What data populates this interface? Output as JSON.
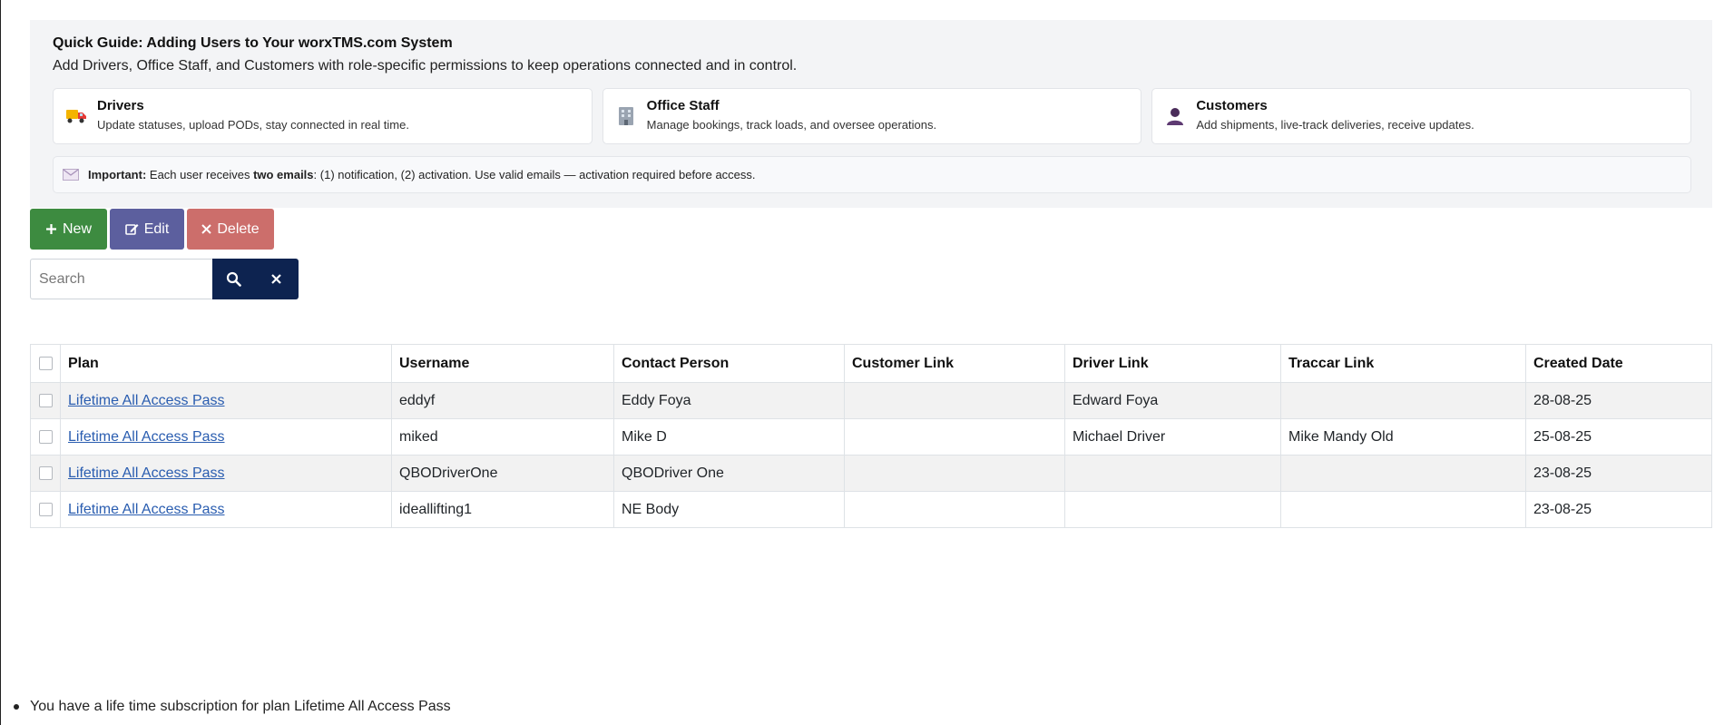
{
  "guide": {
    "title": "Quick Guide: Adding Users to Your worxTMS.com System",
    "subtitle": "Add Drivers, Office Staff, and Customers with role-specific permissions to keep operations connected and in control.",
    "cards": [
      {
        "title": "Drivers",
        "desc": "Update statuses, upload PODs, stay connected in real time.",
        "icon": "truck-icon"
      },
      {
        "title": "Office Staff",
        "desc": "Manage bookings, track loads, and oversee operations.",
        "icon": "office-building-icon"
      },
      {
        "title": "Customers",
        "desc": "Add shipments, live-track deliveries, receive updates.",
        "icon": "person-icon"
      }
    ],
    "important": {
      "label": "Important:",
      "text_a": " Each user receives ",
      "emph": "two emails",
      "text_b": ": (1) notification, (2) activation. Use valid emails — activation required before access.",
      "icon": "envelope-icon"
    }
  },
  "toolbar": {
    "new_label": "New",
    "edit_label": "Edit",
    "delete_label": "Delete",
    "colors": {
      "new": "#3d8b40",
      "edit": "#5c5f9e",
      "delete": "#cc6e6b"
    }
  },
  "search": {
    "placeholder": "Search",
    "value": "",
    "button_color": "#0d2350"
  },
  "table": {
    "columns": [
      "Plan",
      "Username",
      "Contact Person",
      "Customer Link",
      "Driver Link",
      "Traccar Link",
      "Created Date"
    ],
    "rows": [
      {
        "plan": "Lifetime All Access Pass",
        "username": "eddyf",
        "contact": "Eddy Foya",
        "customer_link": "",
        "driver_link": "Edward Foya",
        "traccar_link": "",
        "created": "28-08-25"
      },
      {
        "plan": "Lifetime All Access Pass",
        "username": "miked",
        "contact": "Mike D",
        "customer_link": "",
        "driver_link": "Michael Driver",
        "traccar_link": "Mike Mandy Old",
        "created": "25-08-25"
      },
      {
        "plan": "Lifetime All Access Pass",
        "username": "QBODriverOne",
        "contact": "QBODriver One",
        "customer_link": "",
        "driver_link": "",
        "traccar_link": "",
        "created": "23-08-25"
      },
      {
        "plan": "Lifetime All Access Pass",
        "username": "ideallifting1",
        "contact": "NE Body",
        "customer_link": "",
        "driver_link": "",
        "traccar_link": "",
        "created": "23-08-25"
      }
    ]
  },
  "footer": {
    "note": "You have a life time subscription for plan Lifetime All Access Pass"
  }
}
